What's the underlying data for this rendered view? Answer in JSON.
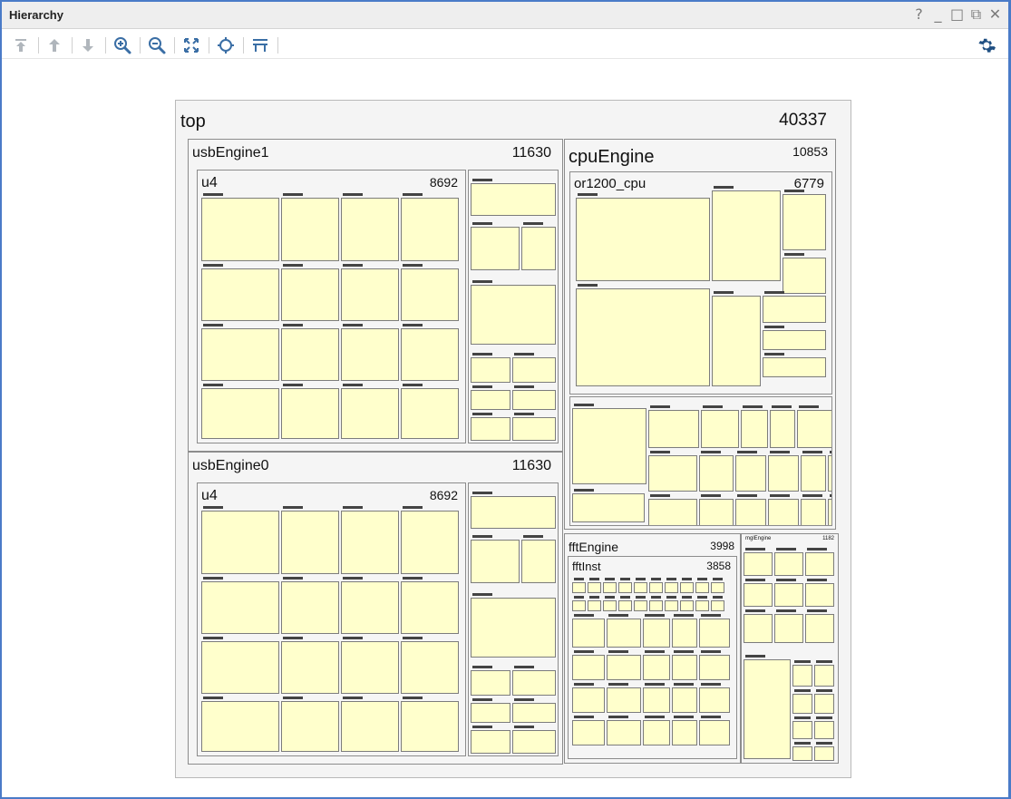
{
  "window": {
    "title": "Hierarchy",
    "controls": [
      "?",
      "_",
      "□",
      "⧉",
      "✕"
    ]
  },
  "toolbar": {
    "buttons": [
      {
        "name": "move-to-top",
        "icon": "arrow-to-top-icon",
        "enabled": false
      },
      {
        "name": "move-up",
        "icon": "arrow-up-icon",
        "enabled": false
      },
      {
        "name": "move-down",
        "icon": "arrow-down-icon",
        "enabled": false
      },
      {
        "name": "zoom-in",
        "icon": "zoom-in-icon",
        "enabled": true
      },
      {
        "name": "zoom-out",
        "icon": "zoom-out-icon",
        "enabled": true
      },
      {
        "name": "zoom-fit",
        "icon": "zoom-fit-icon",
        "enabled": true
      },
      {
        "name": "auto-fit-selection",
        "icon": "crosshair-icon",
        "enabled": true
      },
      {
        "name": "show-hierarchy-levels",
        "icon": "hierarchy-levels-icon",
        "enabled": true
      }
    ],
    "settings_icon": "gear-icon"
  },
  "colors": {
    "accent": "#4a7bc8",
    "leaf": "#ffffcc",
    "node_bg": "#f5f5f5",
    "icon_active": "#3a6ea5",
    "icon_disabled": "#b0b6bc"
  },
  "hierarchy": {
    "top": {
      "name": "top",
      "count": "40337"
    },
    "usbEngine1": {
      "name": "usbEngine1",
      "count": "11630",
      "child": {
        "name": "u4",
        "count": "8692"
      }
    },
    "usbEngine0": {
      "name": "usbEngine0",
      "count": "11630",
      "child": {
        "name": "u4",
        "count": "8692"
      }
    },
    "cpuEngine": {
      "name": "cpuEngine",
      "count": "10853",
      "child": {
        "name": "or1200_cpu",
        "count": "6779"
      }
    },
    "fftEngine": {
      "name": "fftEngine",
      "count": "3998",
      "child": {
        "name": "fftInst",
        "count": "3858"
      }
    },
    "mgEngine": {
      "name": "mglEngine",
      "count": "1182"
    }
  }
}
